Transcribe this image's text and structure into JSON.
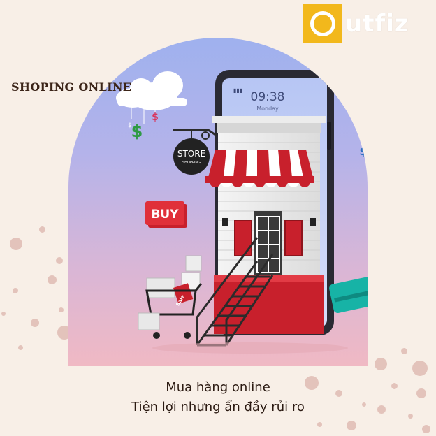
{
  "logo": {
    "text": "utfiz",
    "color": "#f2b81c"
  },
  "headline": "SHOPING ONLINE",
  "illustration": {
    "phone_time": "09:38",
    "phone_day": "Monday",
    "store_sign_title": "STORE",
    "store_sign_sub": "SHOPPING",
    "buy_label": "BUY",
    "cart_tag": "Sale",
    "currency_symbol": "$"
  },
  "caption": {
    "line1": "Mua hàng online",
    "line2": "Tiện lợi nhưng ẩn đầy rủi ro"
  },
  "colors": {
    "background": "#f8efe7",
    "accent_red": "#c8202c",
    "dollar_green": "#2e9a45"
  }
}
